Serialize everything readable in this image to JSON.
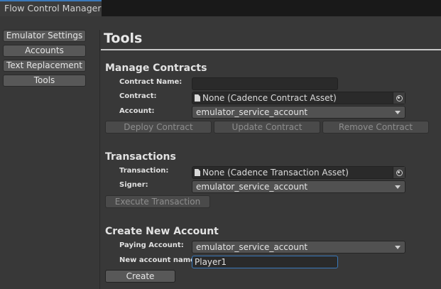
{
  "window": {
    "tab_title": "Flow Control Manager"
  },
  "sidebar": {
    "items": [
      {
        "label": "Emulator Settings"
      },
      {
        "label": "Accounts"
      },
      {
        "label": "Text Replacement"
      },
      {
        "label": "Tools"
      }
    ]
  },
  "main": {
    "title": "Tools",
    "manage_contracts": {
      "heading": "Manage Contracts",
      "contract_name_label": "Contract Name:",
      "contract_name_value": "",
      "contract_label": "Contract:",
      "contract_value": "None (Cadence Contract Asset)",
      "account_label": "Account:",
      "account_value": "emulator_service_account",
      "deploy_label": "Deploy Contract",
      "update_label": "Update Contract",
      "remove_label": "Remove Contract"
    },
    "transactions": {
      "heading": "Transactions",
      "transaction_label": "Transaction:",
      "transaction_value": "None (Cadence Transaction Asset)",
      "signer_label": "Signer:",
      "signer_value": "emulator_service_account",
      "execute_label": "Execute Transaction"
    },
    "create_account": {
      "heading": "Create New Account",
      "paying_label": "Paying Account:",
      "paying_value": "emulator_service_account",
      "name_label": "New account name:",
      "name_value": "Player1",
      "create_label": "Create"
    }
  },
  "colors": {
    "background": "#383838",
    "tab_accent": "#3a79bb",
    "focus_outline": "#3a79bb"
  }
}
